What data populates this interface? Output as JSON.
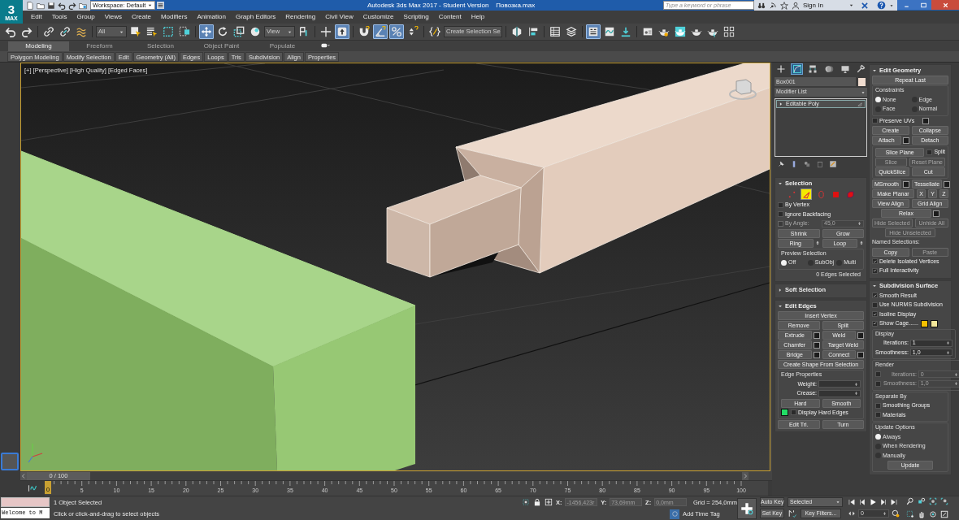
{
  "app_logo": {
    "mark": "3",
    "caption": "MAX"
  },
  "title_bar": {
    "workspace": "Workspace: Default",
    "title": "Autodesk 3ds Max 2017 - Student Version    Повозка.max",
    "search_placeholder": "Type a keyword or phrase",
    "sign_in": "Sign In"
  },
  "menu": [
    "Edit",
    "Tools",
    "Group",
    "Views",
    "Create",
    "Modifiers",
    "Animation",
    "Graph Editors",
    "Rendering",
    "Civil View",
    "Customize",
    "Scripting",
    "Content",
    "Help"
  ],
  "toolbar": [
    {
      "kind": "icon",
      "selected": false
    },
    {
      "kind": "icon",
      "selected": false
    },
    {
      "kind": "separator"
    },
    {
      "kind": "icon",
      "selected": false
    },
    {
      "kind": "icon",
      "selected": false
    },
    {
      "kind": "icon",
      "selected": false
    },
    {
      "kind": "separator"
    },
    {
      "kind": "dropdown",
      "value": "All"
    },
    {
      "kind": "icon",
      "selected": false
    },
    {
      "kind": "icon",
      "selected": false
    },
    {
      "kind": "icon",
      "selected": false
    },
    {
      "kind": "icon",
      "selected": false
    },
    {
      "kind": "separator"
    },
    {
      "kind": "icon",
      "selected": true
    },
    {
      "kind": "icon",
      "selected": false
    },
    {
      "kind": "icon",
      "selected": false
    },
    {
      "kind": "icon",
      "selected": false
    },
    {
      "kind": "dropdown",
      "value": "View"
    },
    {
      "kind": "icon",
      "selected": false
    },
    {
      "kind": "separator"
    },
    {
      "kind": "icon",
      "selected": false
    },
    {
      "kind": "icon",
      "selected": true
    },
    {
      "kind": "separator"
    },
    {
      "kind": "icon",
      "selected": false
    },
    {
      "kind": "icon",
      "selected": true
    },
    {
      "kind": "icon",
      "selected": true
    },
    {
      "kind": "icon",
      "selected": false
    },
    {
      "kind": "separator"
    },
    {
      "kind": "icon",
      "selected": false
    },
    {
      "kind": "dropdown",
      "value": "Create Selection Se"
    },
    {
      "kind": "separator"
    },
    {
      "kind": "icon",
      "selected": false
    },
    {
      "kind": "icon",
      "selected": false
    },
    {
      "kind": "separator"
    },
    {
      "kind": "icon",
      "selected": false
    },
    {
      "kind": "icon",
      "selected": false
    },
    {
      "kind": "separator"
    },
    {
      "kind": "icon",
      "selected": true
    },
    {
      "kind": "icon",
      "selected": false
    },
    {
      "kind": "icon",
      "selected": false
    },
    {
      "kind": "separator"
    },
    {
      "kind": "icon",
      "selected": false
    },
    {
      "kind": "icon",
      "selected": false
    },
    {
      "kind": "icon",
      "selected": false
    },
    {
      "kind": "icon",
      "selected": false
    },
    {
      "kind": "icon",
      "selected": false
    },
    {
      "kind": "icon",
      "selected": false
    }
  ],
  "ribbon_tabs": [
    {
      "label": "Modeling",
      "selected": true
    },
    {
      "label": "Freeform",
      "selected": false
    },
    {
      "label": "Selection",
      "selected": false
    },
    {
      "label": "Object Paint",
      "selected": false
    },
    {
      "label": "Populate",
      "selected": false
    }
  ],
  "ribbon_panels": [
    "Polygon Modeling",
    "Modify Selection",
    "Edit",
    "Geometry (All)",
    "Edges",
    "Loops",
    "Tris",
    "Subdivision",
    "Align",
    "Properties"
  ],
  "viewport": {
    "labels": [
      "[+]",
      "[Perspective]",
      "[High Quality]",
      "[Edged Faces]"
    ]
  },
  "command_panel": {
    "tabs": [
      {
        "selected": false
      },
      {
        "selected": true
      },
      {
        "selected": false
      },
      {
        "selected": false
      },
      {
        "selected": false
      },
      {
        "selected": false
      }
    ],
    "object_name": "Box001",
    "modifier_list": "Modifier List",
    "stack": [
      {
        "label": "Editable Poly",
        "selected": true
      }
    ],
    "rollouts_left": [
      {
        "title": "Selection",
        "expanded": true,
        "rows": [
          [
            {
              "kind": "levels",
              "items": [
                {
                  "selected": false
                },
                {
                  "selected": true
                },
                {
                  "selected": false
                },
                {
                  "selected": false
                },
                {
                  "selected": false
                }
              ]
            }
          ],
          [
            {
              "kind": "checkbox",
              "label": "By Vertex",
              "checked": false
            }
          ],
          [
            {
              "kind": "checkbox",
              "label": "Ignore Backfacing",
              "checked": false
            }
          ],
          [
            {
              "kind": "checkbox",
              "label": "By Angle:",
              "checked": false,
              "disabled": true
            },
            {
              "kind": "spinner",
              "value": "45,0",
              "disabled": true
            }
          ],
          [
            {
              "kind": "button",
              "label": "Shrink"
            },
            {
              "kind": "button",
              "label": "Grow"
            }
          ],
          [
            {
              "kind": "button",
              "label": "Ring",
              "arrows": true
            },
            {
              "kind": "button",
              "label": "Loop",
              "arrows": true
            }
          ],
          [
            {
              "kind": "group",
              "title": "Preview Selection",
              "rows": [
                [
                  {
                    "kind": "radio",
                    "label": "Off",
                    "selected": true
                  },
                  {
                    "kind": "radio",
                    "label": "SubObj",
                    "selected": false
                  },
                  {
                    "kind": "radio",
                    "label": "Multi",
                    "selected": false
                  }
                ]
              ]
            }
          ],
          [
            {
              "kind": "status",
              "label": "0 Edges Selected"
            }
          ]
        ]
      },
      {
        "title": "Soft Selection",
        "expanded": false
      },
      {
        "title": "Edit Edges",
        "expanded": true,
        "rows": [
          [
            {
              "kind": "button",
              "label": "Insert Vertex"
            }
          ],
          [
            {
              "kind": "button",
              "label": "Remove"
            },
            {
              "kind": "button",
              "label": "Split"
            }
          ],
          [
            {
              "kind": "button",
              "label": "Extrude",
              "settings": true
            },
            {
              "kind": "button",
              "label": "Weld",
              "settings": true
            }
          ],
          [
            {
              "kind": "button",
              "label": "Chamfer",
              "settings": true
            },
            {
              "kind": "button",
              "label": "Target Weld"
            }
          ],
          [
            {
              "kind": "button",
              "label": "Bridge",
              "settings": true
            },
            {
              "kind": "button",
              "label": "Connect",
              "settings": true
            }
          ],
          [
            {
              "kind": "button",
              "label": "Create Shape From Selection"
            }
          ],
          [
            {
              "kind": "group",
              "title": "Edge Properties",
              "rows": [
                [
                  {
                    "kind": "spinner",
                    "label": "Weight:"
                  }
                ],
                [
                  {
                    "kind": "spinner",
                    "label": "Crease:"
                  }
                ],
                [
                  {
                    "kind": "button",
                    "label": "Hard"
                  },
                  {
                    "kind": "button",
                    "label": "Smooth"
                  }
                ],
                [
                  {
                    "kind": "swatch",
                    "color": "#22dd66"
                  },
                  {
                    "kind": "checkbox",
                    "label": "Display Hard Edges",
                    "checked": false
                  }
                ]
              ]
            }
          ],
          [
            {
              "kind": "button",
              "label": "Edit Tri."
            },
            {
              "kind": "button",
              "label": "Turn"
            }
          ]
        ]
      }
    ],
    "rollouts_right": [
      {
        "title": "Edit Geometry",
        "expanded": true,
        "rows": [
          [
            {
              "kind": "button",
              "label": "Repeat Last"
            }
          ],
          [
            {
              "kind": "group",
              "title": "Constraints",
              "rows": [
                [
                  {
                    "kind": "radio",
                    "label": "None",
                    "selected": true
                  },
                  {
                    "kind": "radio",
                    "label": "Edge",
                    "selected": false
                  }
                ],
                [
                  {
                    "kind": "radio",
                    "label": "Face",
                    "selected": false
                  },
                  {
                    "kind": "radio",
                    "label": "Normal",
                    "selected": false
                  }
                ]
              ]
            }
          ],
          [
            {
              "kind": "checkbox",
              "label": "Preserve UVs",
              "checked": false,
              "settings": true
            }
          ],
          [
            {
              "kind": "button",
              "label": "Create"
            },
            {
              "kind": "button",
              "label": "Collapse"
            }
          ],
          [
            {
              "kind": "button",
              "label": "Attach",
              "settings": true
            },
            {
              "kind": "button",
              "label": "Detach"
            }
          ],
          [
            {
              "kind": "group",
              "rows": [
                [
                  {
                    "kind": "button",
                    "label": "Slice Plane"
                  },
                  {
                    "kind": "checkbox",
                    "label": "Split",
                    "checked": false
                  }
                ],
                [
                  {
                    "kind": "button",
                    "label": "Slice",
                    "disabled": true
                  },
                  {
                    "kind": "button",
                    "label": "Reset Plane",
                    "disabled": true
                  }
                ],
                [
                  {
                    "kind": "button",
                    "label": "QuickSlice"
                  },
                  {
                    "kind": "button",
                    "label": "Cut"
                  }
                ]
              ]
            }
          ],
          [
            {
              "kind": "button",
              "label": "MSmooth",
              "settings": true
            },
            {
              "kind": "button",
              "label": "Tessellate",
              "settings": true
            }
          ],
          [
            {
              "kind": "button",
              "label": "Make Planar"
            },
            {
              "kind": "button",
              "label": "X",
              "small": true
            },
            {
              "kind": "button",
              "label": "Y",
              "small": true
            },
            {
              "kind": "button",
              "label": "Z",
              "small": true
            }
          ],
          [
            {
              "kind": "button",
              "label": "View Align"
            },
            {
              "kind": "button",
              "label": "Grid Align"
            }
          ],
          [
            {
              "kind": "button",
              "label": "Relax",
              "settings": true,
              "small_center": true
            }
          ],
          [
            {
              "kind": "button",
              "label": "Hide Selected",
              "disabled": true
            },
            {
              "kind": "button",
              "label": "Unhide All",
              "disabled": true
            }
          ],
          [
            {
              "kind": "button",
              "label": "Hide Unselected",
              "disabled": true,
              "small_center": true
            }
          ],
          [
            {
              "kind": "text",
              "label": "Named Selections:"
            }
          ],
          [
            {
              "kind": "button",
              "label": "Copy"
            },
            {
              "kind": "button",
              "label": "Paste",
              "disabled": true
            }
          ],
          [
            {
              "kind": "checkbox",
              "label": "Delete Isolated Vertices",
              "checked": true
            }
          ],
          [
            {
              "kind": "checkbox",
              "label": "Full Interactivity",
              "checked": true
            }
          ]
        ]
      },
      {
        "title": "Subdivision Surface",
        "expanded": true,
        "rows": [
          [
            {
              "kind": "checkbox",
              "label": "Smooth Result",
              "checked": true
            }
          ],
          [
            {
              "kind": "checkbox",
              "label": "Use NURMS Subdivision",
              "checked": false
            }
          ],
          [
            {
              "kind": "checkbox",
              "label": "Isoline Display",
              "checked": true
            }
          ],
          [
            {
              "kind": "checkbox",
              "label": "Show Cage......",
              "checked": true
            },
            {
              "kind": "swatch",
              "color": "#f5c000"
            },
            {
              "kind": "swatch",
              "color": "#f3e79a"
            }
          ],
          [
            {
              "kind": "group",
              "title": "Display",
              "rows": [
                [
                  {
                    "kind": "spinner",
                    "label": "Iterations:",
                    "value": "1"
                  }
                ],
                [
                  {
                    "kind": "spinner",
                    "label": "Smoothness:",
                    "value": "1,0"
                  }
                ]
              ]
            }
          ],
          [
            {
              "kind": "group",
              "title": "Render",
              "rows": [
                [
                  {
                    "kind": "checkbox",
                    "checked": false
                  },
                  {
                    "kind": "spinner",
                    "label": "Iterations:",
                    "value": "0",
                    "disabled": true
                  }
                ],
                [
                  {
                    "kind": "checkbox",
                    "checked": false
                  },
                  {
                    "kind": "spinner",
                    "label": "Smoothness:",
                    "value": "1,0",
                    "disabled": true
                  }
                ]
              ]
            }
          ],
          [
            {
              "kind": "group",
              "title": "Separate By",
              "rows": [
                [
                  {
                    "kind": "checkbox",
                    "label": "Smoothing Groups",
                    "checked": false
                  }
                ],
                [
                  {
                    "kind": "checkbox",
                    "label": "Materials",
                    "checked": false
                  }
                ]
              ]
            }
          ],
          [
            {
              "kind": "group",
              "title": "Update Options",
              "rows": [
                [
                  {
                    "kind": "radio",
                    "label": "Always",
                    "selected": true
                  }
                ],
                [
                  {
                    "kind": "radio",
                    "label": "When Rendering",
                    "selected": false
                  }
                ],
                [
                  {
                    "kind": "radio",
                    "label": "Manually",
                    "selected": false
                  }
                ],
                [
                  {
                    "kind": "button",
                    "label": "Update",
                    "small_center": true
                  }
                ]
              ]
            }
          ]
        ]
      }
    ]
  },
  "timeline": {
    "position": "0 / 100",
    "level": 0,
    "current_frame": "0",
    "tick_labels": [
      "5",
      "10",
      "15",
      "20",
      "25",
      "30",
      "35",
      "40",
      "45",
      "50",
      "55",
      "60",
      "65",
      "70",
      "75",
      "80",
      "85",
      "90",
      "95",
      "100"
    ]
  },
  "status_bar": {
    "listener_output": "Welcome to M",
    "selection_info": "1 Object Selected",
    "prompt": "Click or click-and-drag to select objects",
    "coordinates": [
      {
        "label": "X:",
        "value": "-1456,423r"
      },
      {
        "label": "Y:",
        "value": "73,69mm"
      },
      {
        "label": "Z:",
        "value": "0,0mm"
      }
    ],
    "grid": "Grid = 254,0mm",
    "time_tag": "Add Time Tag",
    "auto_key": "Auto Key",
    "set_key": "Set Key",
    "key_mode": "Selected",
    "key_filters": "Key Filters...",
    "frame": "0"
  }
}
